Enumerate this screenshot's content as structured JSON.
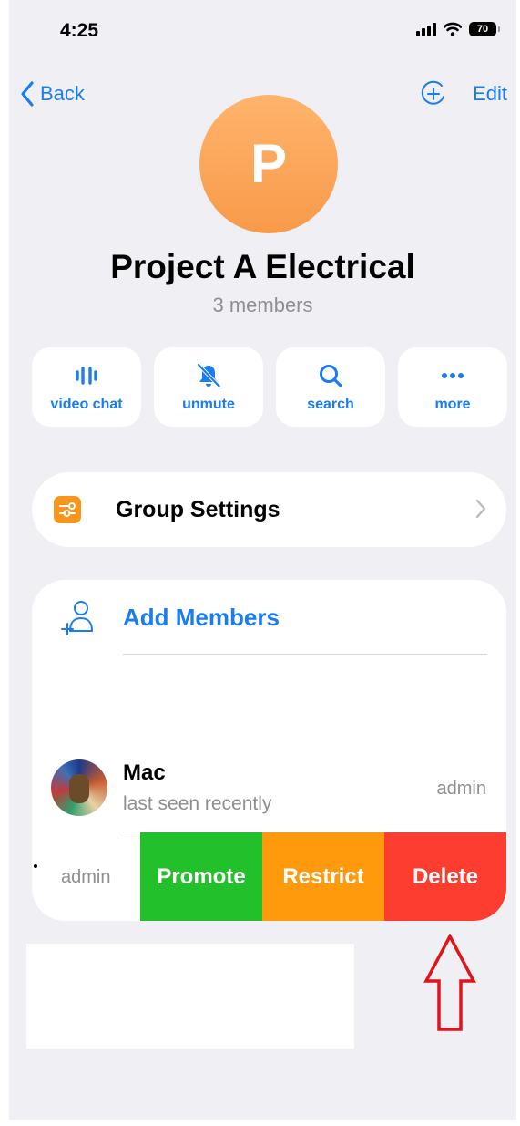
{
  "status_bar": {
    "time": "4:25",
    "battery": "70"
  },
  "nav": {
    "back_label": "Back",
    "edit_label": "Edit"
  },
  "group": {
    "avatar_letter": "P",
    "title": "Project A Electrical",
    "subtitle": "3 members"
  },
  "actions": [
    {
      "label": "video chat",
      "icon": "video-chat-icon"
    },
    {
      "label": "unmute",
      "icon": "bell-muted-icon"
    },
    {
      "label": "search",
      "icon": "search-icon"
    },
    {
      "label": "more",
      "icon": "more-icon"
    }
  ],
  "settings": {
    "label": "Group Settings"
  },
  "members": {
    "add_label": "Add Members",
    "list": [
      {
        "name": "Mac",
        "status": "last seen recently",
        "role": "admin"
      }
    ],
    "swipe": {
      "role": "admin",
      "promote": "Promote",
      "restrict": "Restrict",
      "delete": "Delete"
    }
  },
  "colors": {
    "accent": "#1a7cf0",
    "promote": "#22c02a",
    "restrict": "#fe9a0c",
    "delete": "#fd3d2f",
    "annotation_arrow": "#e0141b"
  }
}
